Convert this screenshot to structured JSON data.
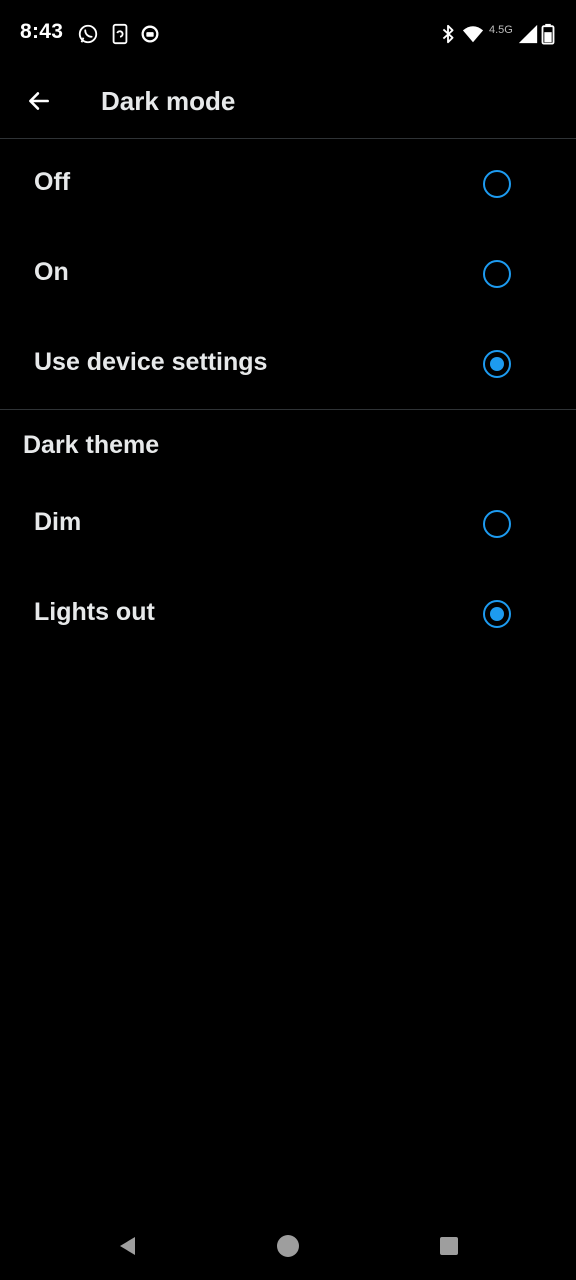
{
  "status_bar": {
    "time": "8:43",
    "network_label": "4.5G",
    "left_icons": [
      "whatsapp-icon",
      "phone-sync-icon",
      "media-icon"
    ],
    "right_icons": [
      "bluetooth-icon",
      "wifi-icon",
      "cellular-signal-icon",
      "battery-icon"
    ]
  },
  "header": {
    "title": "Dark mode",
    "back_icon": "back-arrow-icon"
  },
  "dark_mode": {
    "options": [
      {
        "label": "Off",
        "selected": false
      },
      {
        "label": "On",
        "selected": false
      },
      {
        "label": "Use device settings",
        "selected": true
      }
    ]
  },
  "dark_theme": {
    "heading": "Dark theme",
    "options": [
      {
        "label": "Dim",
        "selected": false
      },
      {
        "label": "Lights out",
        "selected": true
      }
    ]
  },
  "colors": {
    "accent": "#1d9bf0",
    "background": "#000000",
    "text": "#e7e9ea",
    "divider": "#2f3336"
  },
  "nav_bar": {
    "icons": [
      "back-triangle-icon",
      "home-circle-icon",
      "recents-square-icon"
    ]
  }
}
